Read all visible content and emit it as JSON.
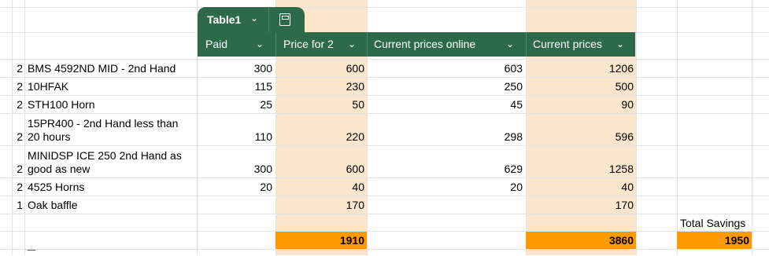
{
  "table_tab": {
    "name": "Table1"
  },
  "headers": {
    "paid": "Paid",
    "price_for_2": "Price for 2",
    "current_online": "Current prices online",
    "current_prices": "Current prices"
  },
  "rows": [
    {
      "qty": "2",
      "item": "BMS 4592ND MID - 2nd Hand",
      "paid": "300",
      "price2": "600",
      "online": "603",
      "current": "1206"
    },
    {
      "qty": "2",
      "item": "10HFAK",
      "paid": "115",
      "price2": "230",
      "online": "250",
      "current": "500"
    },
    {
      "qty": "2",
      "item": "STH100 Horn",
      "paid": "25",
      "price2": "50",
      "online": "45",
      "current": "90"
    },
    {
      "qty": "2",
      "item_line1": "15PR400 - 2nd Hand less than",
      "item_line2": "20 hours",
      "paid": "110",
      "price2": "220",
      "online": "298",
      "current": "596"
    },
    {
      "qty": "2",
      "item_line1": "MINIDSP ICE 250 2nd Hand as",
      "item_line2": "good as new",
      "paid": "300",
      "price2": "600",
      "online": "629",
      "current": "1258"
    },
    {
      "qty": "2",
      "item": "4525 Horns",
      "paid": "20",
      "price2": "40",
      "online": "20",
      "current": "40"
    },
    {
      "qty": "1",
      "item": "Oak baffle",
      "paid": "",
      "price2": "170",
      "online": "",
      "current": "170"
    }
  ],
  "totals": {
    "label": "Total Savings",
    "price2_total": "1910",
    "current_total": "3860",
    "savings": "1950"
  },
  "colors": {
    "table_header": "#2d6a4a",
    "price_band": "#fce5cd",
    "total_highlight": "#ff9900"
  }
}
